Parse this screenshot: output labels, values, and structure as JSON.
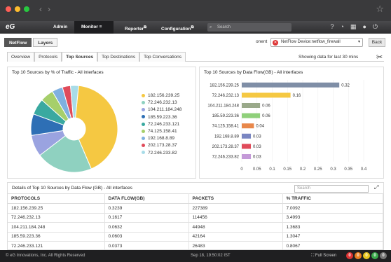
{
  "window": {
    "dots": [
      "#ff5f57",
      "#febc2e",
      "#28c840"
    ]
  },
  "appbar": {
    "logo": "eG",
    "nav": [
      "Admin",
      "Monitor",
      "Reporter",
      "Configuration"
    ],
    "search_placeholder": "Search"
  },
  "toolbar": {
    "tabs": [
      "NetFlow",
      "Layers"
    ],
    "component_label": "onent",
    "device": "NetFlow Device:netflow_firewall",
    "back_label": "Back"
  },
  "tabs": [
    "Overview",
    "Protocols",
    "Top Sources",
    "Top Destinations",
    "Top Conversations"
  ],
  "showing": "Showing data for last 30 mins",
  "pie": {
    "title": "Top 10 Sources by % of Traffic - All interfaces",
    "legend": [
      "182.156.239.25",
      "72.246.232.13",
      "104.211.184.248",
      "185.59.223.36",
      "72.246.233.121",
      "74.125.158.41",
      "192.168.8.89",
      "202.173.28.37",
      "72.246.233.82"
    ]
  },
  "chart_data": {
    "type": "bar",
    "title": "Top 10 Sources by Data Flow(GB) - All interfaces",
    "categories": [
      "182.156.239.25",
      "72.246.232.13",
      "104.211.184.248",
      "185.59.223.36",
      "74.125.158.41",
      "192.168.8.89",
      "202.173.28.37",
      "72.246.233.82"
    ],
    "values": [
      0.32,
      0.16,
      0.06,
      0.06,
      0.04,
      0.03,
      0.03,
      0.03
    ],
    "value_labels": [
      "0.32",
      "0.16",
      "0.06",
      "0.06",
      "0.04",
      "0.03",
      "0.03",
      "0.03"
    ],
    "colors": [
      "#7f8ea6",
      "#f5c842",
      "#9aa98a",
      "#8fd07a",
      "#e8874a",
      "#7a86c2",
      "#e04b5a",
      "#c49ad8"
    ],
    "xlim": [
      0,
      0.4
    ],
    "ticks": [
      "0",
      "0.05",
      "0.1",
      "0.15",
      "0.2",
      "0.25",
      "0.3",
      "0.35",
      "0.4"
    ]
  },
  "table": {
    "title": "Details of Top 10 Sources by Data Flow (GB) - All interfaces",
    "search_placeholder": "Search",
    "headers": [
      "PROTOCOLS",
      "DATA FLOW(GB)",
      "PACKETS",
      "% TRAFFIC"
    ],
    "rows": [
      [
        "182.156.239.25",
        "0.3239",
        "227389",
        "7.0092"
      ],
      [
        "72.246.232.13",
        "0.1617",
        "114456",
        "3.4993"
      ],
      [
        "104.211.184.248",
        "0.0632",
        "44948",
        "1.3683"
      ],
      [
        "185.59.223.36",
        "0.0603",
        "42164",
        "1.3047"
      ],
      [
        "72.246.233.121",
        "0.0373",
        "26483",
        "0.8067"
      ]
    ]
  },
  "footer": {
    "copyright": "© eG Innovations, Inc. All Rights Reserved",
    "datetime": "Sep 18, 19:50:02 IST",
    "fullscreen": "Full Screen",
    "status_counts": [
      "0",
      "0",
      "0",
      "0",
      "0"
    ]
  }
}
